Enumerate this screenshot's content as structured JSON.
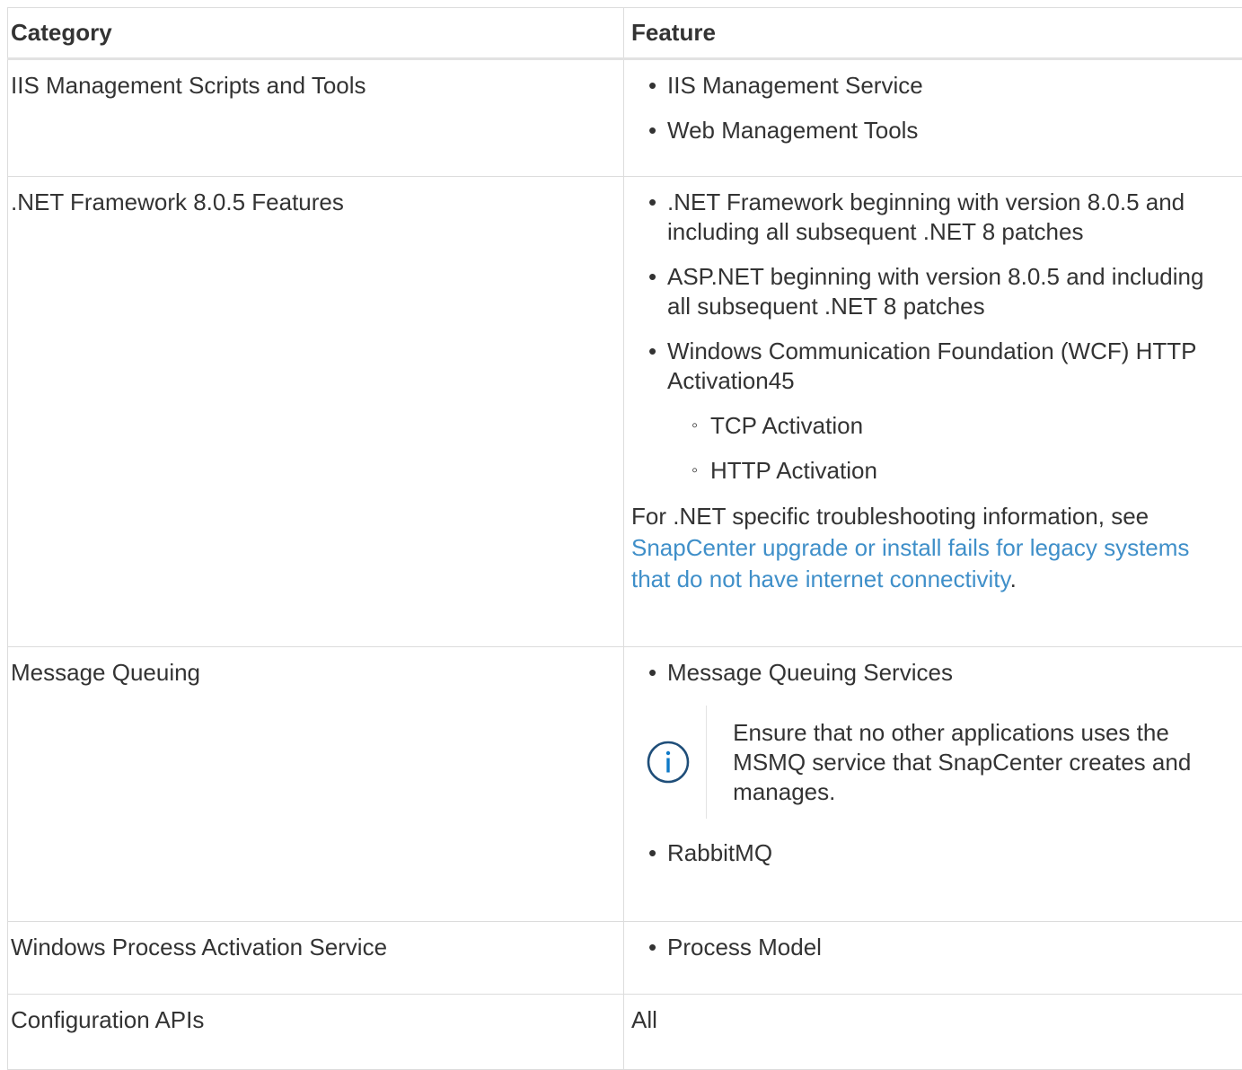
{
  "table": {
    "headers": {
      "category": "Category",
      "feature": "Feature"
    },
    "rows": {
      "iis": {
        "category": "IIS Management Scripts and Tools",
        "features": [
          "IIS Management Service",
          "Web Management Tools"
        ]
      },
      "net": {
        "category": ".NET Framework 8.0.5 Features",
        "features": [
          ".NET Framework beginning with version 8.0.5 and including all subsequent .NET 8 patches",
          "ASP.NET beginning with version 8.0.5 and including all subsequent .NET 8 patches",
          "Windows Communication Foundation (WCF) HTTP Activation45"
        ],
        "sub_features": [
          "TCP Activation",
          "HTTP Activation"
        ],
        "troubleshoot_text": "For .NET specific troubleshooting information, see ",
        "troubleshoot_link": "SnapCenter upgrade or install fails for legacy systems that do not have internet connectivity",
        "troubleshoot_end": "."
      },
      "mq": {
        "category": "Message Queuing",
        "features": [
          "Message Queuing Services",
          "RabbitMQ"
        ],
        "note_icon": "info-circle-icon",
        "note_text": "Ensure that no other applications uses the MSMQ service that SnapCenter creates and manages."
      },
      "was": {
        "category": "Windows Process Activation Service",
        "features": [
          "Process Model"
        ]
      },
      "api": {
        "category": "Configuration APIs",
        "feature": "All"
      }
    }
  },
  "colors": {
    "text": "#333333",
    "link": "#3f8fc9",
    "border": "#dcdcdc",
    "icon": "#1f4e79"
  }
}
